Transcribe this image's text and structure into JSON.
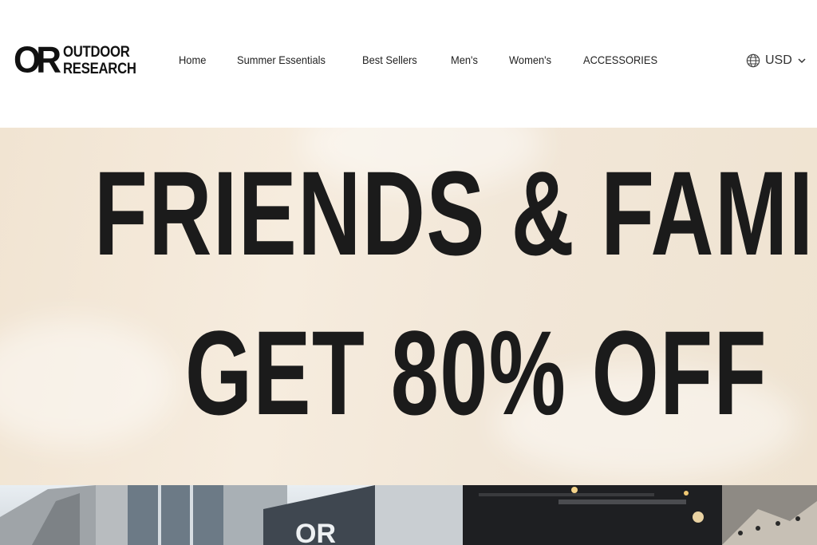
{
  "brand": {
    "mark": "OR",
    "line1": "OUTDOOR",
    "line2": "RESEARCH"
  },
  "nav": {
    "items": [
      {
        "label": "Home"
      },
      {
        "label": "Summer Essentials"
      },
      {
        "label": "Best Sellers"
      },
      {
        "label": "Men's"
      },
      {
        "label": "Women's"
      },
      {
        "label": "ACCESSORIES"
      }
    ]
  },
  "currency": {
    "value": "USD",
    "icon": "globe-icon",
    "chevron": "chevron-down-icon"
  },
  "hero": {
    "line1": "FRIENDS & FAMILY",
    "line2": "GET 80% OFF"
  },
  "photo": {
    "sign_text": "OR"
  },
  "colors": {
    "text": "#1b1b1b",
    "hero_bg": "#f3e8d8",
    "nav_text": "#222222"
  }
}
